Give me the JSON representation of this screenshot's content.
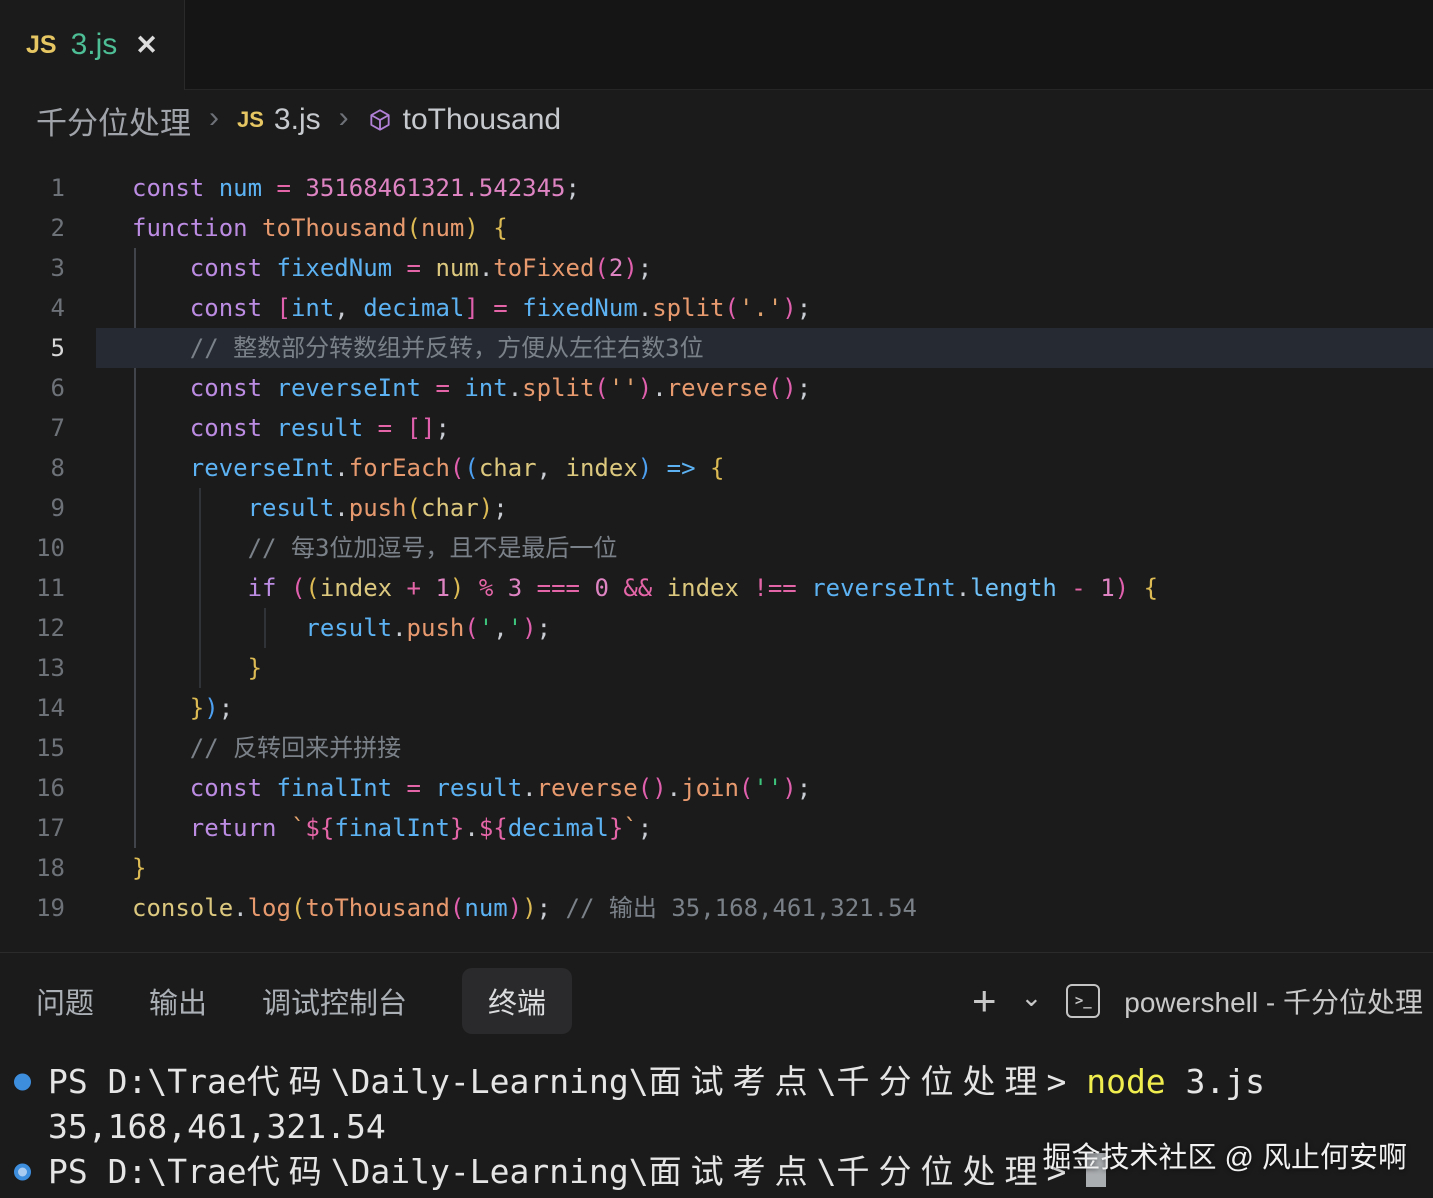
{
  "tab_bar": {
    "tab": {
      "icon_label": "JS",
      "label": "3.js",
      "close_glyph": "✕"
    }
  },
  "breadcrumb": {
    "folder": "千分位处理",
    "sep": "›",
    "file_icon_label": "JS",
    "file": "3.js",
    "symbol": "toThousand"
  },
  "editor": {
    "lines": [
      {
        "n": "1",
        "seg": [
          {
            "c": "kw",
            "t": "const "
          },
          {
            "c": "vr",
            "t": "num "
          },
          {
            "c": "op",
            "t": "= "
          },
          {
            "c": "nm",
            "t": "35168461321.542345"
          },
          {
            "c": "pn",
            "t": ";"
          }
        ]
      },
      {
        "n": "2",
        "seg": [
          {
            "c": "kw",
            "t": "function "
          },
          {
            "c": "fn",
            "t": "toThousand"
          },
          {
            "c": "by",
            "t": "("
          },
          {
            "c": "fn",
            "t": "num"
          },
          {
            "c": "by",
            "t": ")"
          },
          {
            "c": "pn",
            "t": " "
          },
          {
            "c": "by",
            "t": "{"
          }
        ]
      },
      {
        "n": "3",
        "seg": [
          {
            "c": "pn",
            "t": "    "
          },
          {
            "c": "kw",
            "t": "const "
          },
          {
            "c": "vr",
            "t": "fixedNum "
          },
          {
            "c": "op",
            "t": "= "
          },
          {
            "c": "pm",
            "t": "num"
          },
          {
            "c": "pn",
            "t": "."
          },
          {
            "c": "fn",
            "t": "toFixed"
          },
          {
            "c": "bp",
            "t": "("
          },
          {
            "c": "nm",
            "t": "2"
          },
          {
            "c": "bp",
            "t": ")"
          },
          {
            "c": "pn",
            "t": ";"
          }
        ]
      },
      {
        "n": "4",
        "seg": [
          {
            "c": "pn",
            "t": "    "
          },
          {
            "c": "kw",
            "t": "const "
          },
          {
            "c": "bp",
            "t": "["
          },
          {
            "c": "vr",
            "t": "int"
          },
          {
            "c": "pn",
            "t": ", "
          },
          {
            "c": "vr",
            "t": "decimal"
          },
          {
            "c": "bp",
            "t": "]"
          },
          {
            "c": "op",
            "t": " = "
          },
          {
            "c": "vr",
            "t": "fixedNum"
          },
          {
            "c": "pn",
            "t": "."
          },
          {
            "c": "fn",
            "t": "split"
          },
          {
            "c": "bp",
            "t": "("
          },
          {
            "c": "st",
            "t": "'.'"
          },
          {
            "c": "bp",
            "t": ")"
          },
          {
            "c": "pn",
            "t": ";"
          }
        ]
      },
      {
        "n": "5",
        "current": true,
        "seg": [
          {
            "c": "pn",
            "t": "    "
          },
          {
            "c": "cm",
            "t": "// 整数部分转数组并反转，方便从左往右数3位"
          }
        ]
      },
      {
        "n": "6",
        "seg": [
          {
            "c": "pn",
            "t": "    "
          },
          {
            "c": "kw",
            "t": "const "
          },
          {
            "c": "vr",
            "t": "reverseInt "
          },
          {
            "c": "op",
            "t": "= "
          },
          {
            "c": "vr",
            "t": "int"
          },
          {
            "c": "pn",
            "t": "."
          },
          {
            "c": "fn",
            "t": "split"
          },
          {
            "c": "bp",
            "t": "("
          },
          {
            "c": "st",
            "t": "''"
          },
          {
            "c": "bp",
            "t": ")"
          },
          {
            "c": "pn",
            "t": "."
          },
          {
            "c": "fn",
            "t": "reverse"
          },
          {
            "c": "bp",
            "t": "()"
          },
          {
            "c": "pn",
            "t": ";"
          }
        ]
      },
      {
        "n": "7",
        "seg": [
          {
            "c": "pn",
            "t": "    "
          },
          {
            "c": "kw",
            "t": "const "
          },
          {
            "c": "vr",
            "t": "result "
          },
          {
            "c": "op",
            "t": "= "
          },
          {
            "c": "bp",
            "t": "[]"
          },
          {
            "c": "pn",
            "t": ";"
          }
        ]
      },
      {
        "n": "8",
        "seg": [
          {
            "c": "pn",
            "t": "    "
          },
          {
            "c": "vr",
            "t": "reverseInt"
          },
          {
            "c": "pn",
            "t": "."
          },
          {
            "c": "fn",
            "t": "forEach"
          },
          {
            "c": "bp",
            "t": "("
          },
          {
            "c": "bb",
            "t": "("
          },
          {
            "c": "pm",
            "t": "char"
          },
          {
            "c": "pn",
            "t": ", "
          },
          {
            "c": "pm",
            "t": "index"
          },
          {
            "c": "bb",
            "t": ")"
          },
          {
            "c": "vr",
            "t": " => "
          },
          {
            "c": "by",
            "t": "{"
          }
        ]
      },
      {
        "n": "9",
        "seg": [
          {
            "c": "pn",
            "t": "        "
          },
          {
            "c": "vr",
            "t": "result"
          },
          {
            "c": "pn",
            "t": "."
          },
          {
            "c": "fn",
            "t": "push"
          },
          {
            "c": "by",
            "t": "("
          },
          {
            "c": "pm",
            "t": "char"
          },
          {
            "c": "by",
            "t": ")"
          },
          {
            "c": "pn",
            "t": ";"
          }
        ]
      },
      {
        "n": "10",
        "seg": [
          {
            "c": "pn",
            "t": "        "
          },
          {
            "c": "cm",
            "t": "// 每3位加逗号，且不是最后一位"
          }
        ]
      },
      {
        "n": "11",
        "seg": [
          {
            "c": "pn",
            "t": "        "
          },
          {
            "c": "kw",
            "t": "if "
          },
          {
            "c": "bp",
            "t": "("
          },
          {
            "c": "by",
            "t": "("
          },
          {
            "c": "pm",
            "t": "index"
          },
          {
            "c": "op",
            "t": " + "
          },
          {
            "c": "nm",
            "t": "1"
          },
          {
            "c": "by",
            "t": ")"
          },
          {
            "c": "op",
            "t": " % "
          },
          {
            "c": "nm",
            "t": "3"
          },
          {
            "c": "op",
            "t": " === "
          },
          {
            "c": "nm",
            "t": "0"
          },
          {
            "c": "op",
            "t": " && "
          },
          {
            "c": "pm",
            "t": "index"
          },
          {
            "c": "op",
            "t": " !== "
          },
          {
            "c": "vr",
            "t": "reverseInt"
          },
          {
            "c": "pn",
            "t": "."
          },
          {
            "c": "pr",
            "t": "length"
          },
          {
            "c": "op",
            "t": " - "
          },
          {
            "c": "nm",
            "t": "1"
          },
          {
            "c": "bp",
            "t": ")"
          },
          {
            "c": "pn",
            "t": " "
          },
          {
            "c": "by",
            "t": "{"
          }
        ]
      },
      {
        "n": "12",
        "seg": [
          {
            "c": "pn",
            "t": "            "
          },
          {
            "c": "vr",
            "t": "result"
          },
          {
            "c": "pn",
            "t": "."
          },
          {
            "c": "fn",
            "t": "push"
          },
          {
            "c": "bp",
            "t": "("
          },
          {
            "c": "sg",
            "t": "'"
          },
          {
            "c": "pn",
            "t": ","
          },
          {
            "c": "sg",
            "t": "'"
          },
          {
            "c": "bp",
            "t": ")"
          },
          {
            "c": "pn",
            "t": ";"
          }
        ]
      },
      {
        "n": "13",
        "seg": [
          {
            "c": "pn",
            "t": "        "
          },
          {
            "c": "by",
            "t": "}"
          }
        ]
      },
      {
        "n": "14",
        "seg": [
          {
            "c": "pn",
            "t": "    "
          },
          {
            "c": "by",
            "t": "}"
          },
          {
            "c": "bb",
            "t": ")"
          },
          {
            "c": "pn",
            "t": ";"
          }
        ]
      },
      {
        "n": "15",
        "seg": [
          {
            "c": "pn",
            "t": "    "
          },
          {
            "c": "cm",
            "t": "// 反转回来并拼接"
          }
        ]
      },
      {
        "n": "16",
        "seg": [
          {
            "c": "pn",
            "t": "    "
          },
          {
            "c": "kw",
            "t": "const "
          },
          {
            "c": "vr",
            "t": "finalInt "
          },
          {
            "c": "op",
            "t": "= "
          },
          {
            "c": "vr",
            "t": "result"
          },
          {
            "c": "pn",
            "t": "."
          },
          {
            "c": "fn",
            "t": "reverse"
          },
          {
            "c": "bp",
            "t": "()"
          },
          {
            "c": "pn",
            "t": "."
          },
          {
            "c": "fn",
            "t": "join"
          },
          {
            "c": "bp",
            "t": "("
          },
          {
            "c": "sg",
            "t": "''"
          },
          {
            "c": "bp",
            "t": ")"
          },
          {
            "c": "pn",
            "t": ";"
          }
        ]
      },
      {
        "n": "17",
        "seg": [
          {
            "c": "pn",
            "t": "    "
          },
          {
            "c": "kw",
            "t": "return "
          },
          {
            "c": "st",
            "t": "`"
          },
          {
            "c": "op",
            "t": "${"
          },
          {
            "c": "vr",
            "t": "finalInt"
          },
          {
            "c": "op",
            "t": "}"
          },
          {
            "c": "pn",
            "t": "."
          },
          {
            "c": "op",
            "t": "${"
          },
          {
            "c": "vr",
            "t": "decimal"
          },
          {
            "c": "op",
            "t": "}"
          },
          {
            "c": "st",
            "t": "`"
          },
          {
            "c": "pn",
            "t": ";"
          }
        ]
      },
      {
        "n": "18",
        "seg": [
          {
            "c": "by",
            "t": "}"
          }
        ]
      },
      {
        "n": "19",
        "seg": [
          {
            "c": "pm",
            "t": "console"
          },
          {
            "c": "pn",
            "t": "."
          },
          {
            "c": "fn",
            "t": "log"
          },
          {
            "c": "by",
            "t": "("
          },
          {
            "c": "fn",
            "t": "toThousand"
          },
          {
            "c": "bp",
            "t": "("
          },
          {
            "c": "vr",
            "t": "num"
          },
          {
            "c": "bp",
            "t": ")"
          },
          {
            "c": "by",
            "t": ")"
          },
          {
            "c": "pn",
            "t": ";"
          },
          {
            "c": "cm",
            "t": " // 输出 35,168,461,321.54"
          }
        ]
      }
    ]
  },
  "panel": {
    "tabs": [
      {
        "name": "problems",
        "label": "问题",
        "active": false
      },
      {
        "name": "output",
        "label": "输出",
        "active": false
      },
      {
        "name": "debug-console",
        "label": "调试控制台",
        "active": false
      },
      {
        "name": "terminal",
        "label": "终端",
        "active": true
      }
    ],
    "plus_glyph": "+",
    "chevron_glyph": "⌄",
    "ps_icon_glyph": ">_",
    "terminal_title": "powershell - 千分位处理"
  },
  "terminal": {
    "rows": [
      {
        "bullet": "solid",
        "seg": [
          {
            "c": "tw",
            "t": "PS D:\\Trae"
          },
          {
            "c": "tw cj",
            "t": "代码"
          },
          {
            "c": "tw",
            "t": "\\Daily-Learning\\"
          },
          {
            "c": "tw cj",
            "t": "面试考点"
          },
          {
            "c": "tw",
            "t": "\\"
          },
          {
            "c": "tw cj",
            "t": "千分位处理"
          },
          {
            "c": "tw",
            "t": "> "
          },
          {
            "c": "ty",
            "t": "node "
          },
          {
            "c": "tw",
            "t": "3.js"
          }
        ]
      },
      {
        "bullet": null,
        "seg": [
          {
            "c": "tw",
            "t": "35,168,461,321.54"
          }
        ]
      },
      {
        "bullet": "ring",
        "cursor": true,
        "seg": [
          {
            "c": "tw",
            "t": "PS D:\\Trae"
          },
          {
            "c": "tw cj",
            "t": "代码"
          },
          {
            "c": "tw",
            "t": "\\Daily-Learning\\"
          },
          {
            "c": "tw cj",
            "t": "面试考点"
          },
          {
            "c": "tw",
            "t": "\\"
          },
          {
            "c": "tw cj",
            "t": "千分位处理"
          },
          {
            "c": "tw",
            "t": "> "
          }
        ]
      }
    ],
    "watermark": "掘金技术社区 @ 风止何安啊"
  },
  "palette": {
    "background": "#1B1B1B",
    "tabbar_background": "#151515",
    "border": "#2A2A2A",
    "current_line": "#262B33",
    "keyword": "#BC8CE3",
    "variable": "#5CB2F2",
    "function": "#E89A6F",
    "parameter": "#DCC87E",
    "operator": "#E566A8",
    "number": "#DE84C3",
    "string_orange": "#E3A36E",
    "string_green": "#3EC57C",
    "comment": "#7B8188",
    "bracket_gold": "#DCBA54",
    "bracket_pink": "#E060AE",
    "bracket_blue": "#4D9FF0",
    "tab_filename_green": "#4DBE95",
    "js_icon_yellow": "#E5C662",
    "symbol_icon_purple": "#B180D7",
    "terminal_bullet_blue": "#3E8EDE",
    "terminal_command_yellow": "#F0EE4F"
  }
}
